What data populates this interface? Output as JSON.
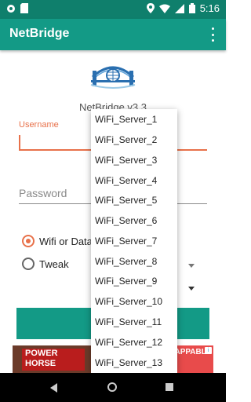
{
  "status_bar": {
    "time": "5:16",
    "icons": [
      "settings-icon",
      "sim-card-icon",
      "location-icon",
      "wifi-icon",
      "signal-icon",
      "battery-icon"
    ]
  },
  "app_bar": {
    "title": "NetBridge",
    "menu_icon": "more-vert-icon"
  },
  "header": {
    "version": "NetBridge v3.3"
  },
  "form": {
    "username_label": "Username",
    "username_value": "",
    "password_placeholder": "Password",
    "radio_wifi_label": "Wifi or Data)",
    "radio_tweak_label": "Tweak",
    "radio_selected": "wifi"
  },
  "dropdown": {
    "items": [
      "WiFi_Server_1",
      "WiFi_Server_2",
      "WiFi_Server_3",
      "WiFi_Server_4",
      "WiFi_Server_5",
      "WiFi_Server_6",
      "WiFi_Server_7",
      "WiFi_Server_8",
      "WiFi_Server_9",
      "WiFi_Server_10",
      "WiFi_Server_11",
      "WiFi_Server_12",
      "WiFi_Server_13"
    ]
  },
  "button": {
    "label_visible": "C"
  },
  "ad": {
    "brand": "POWER HORSE",
    "right_text": "APPABLE"
  },
  "colors": {
    "primary": "#139a86",
    "primary_dark": "#0f7f6c",
    "accent": "#e8714a"
  }
}
